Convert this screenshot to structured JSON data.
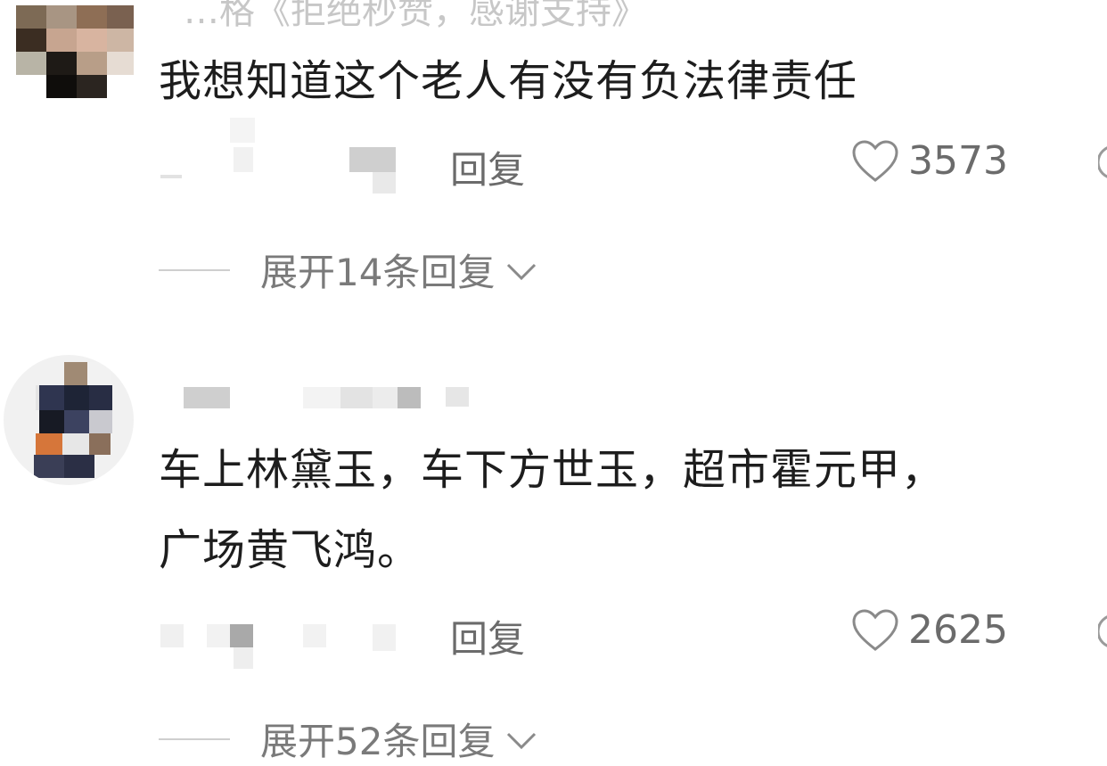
{
  "top_cut_text": "…格《拒绝秒赞，感谢支持》",
  "comments": [
    {
      "text_lines": [
        "我想知道这个老人有没有负法律责任"
      ],
      "reply_label": "回复",
      "likes": "3573",
      "expand_label": "展开14条回复"
    },
    {
      "text_lines": [
        "车上林黛玉，车下方世玉，超市霍元甲，",
        "广场黄飞鸿。"
      ],
      "reply_label": "回复",
      "likes": "2625",
      "expand_label": "展开52条回复"
    }
  ],
  "icons": {
    "like": "heart-outline-icon",
    "expand": "chevron-down-icon"
  },
  "colors": {
    "text": "#1d1d1d",
    "meta": "#6b6b6b",
    "muted": "#c7c7c7"
  }
}
